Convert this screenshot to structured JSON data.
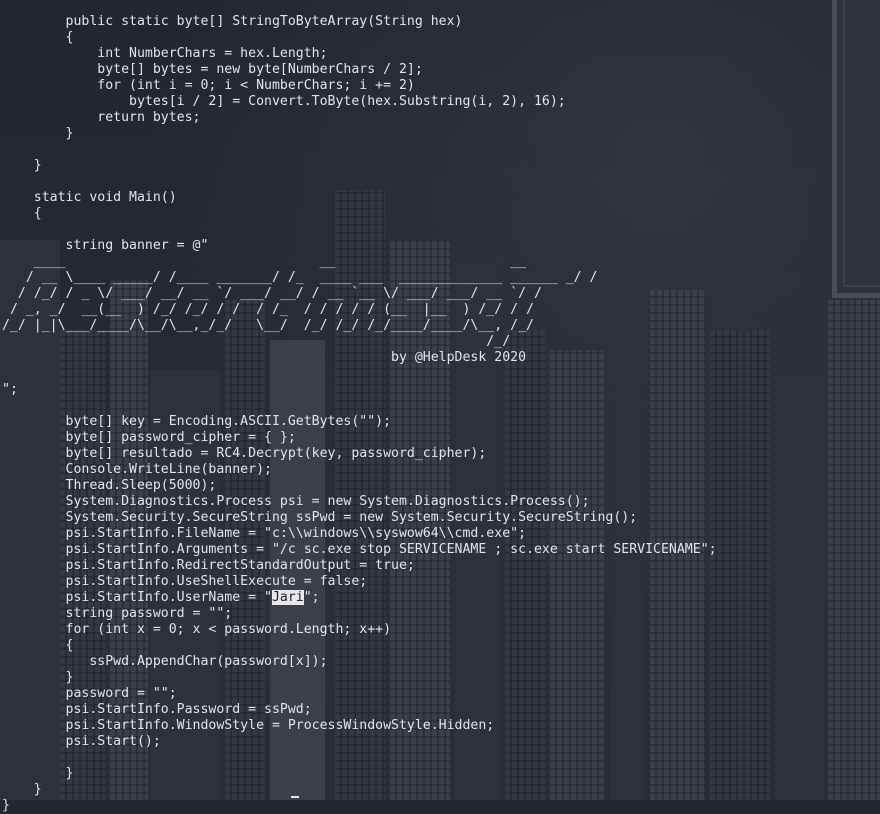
{
  "terminal": {
    "lines": [
      "        public static byte[] StringToByteArray(String hex)",
      "        {",
      "            int NumberChars = hex.Length;",
      "            byte[] bytes = new byte[NumberChars / 2];",
      "            for (int i = 0; i < NumberChars; i += 2)",
      "                bytes[i / 2] = Convert.ToByte(hex.Substring(i, 2), 16);",
      "            return bytes;",
      "        }",
      "",
      "    }",
      "",
      "    static void Main()",
      "    {",
      "",
      "        string banner = @\"",
      "    ____                                __                      __",
      "   / __ \\____ _____/ /____ _______/ /_  ____ ___  _____________ ______ _/ /",
      "  / /_/ / _ \\/ ___/ __/ __ `/ ___/ __/ / __ `__ \\/ ___/ ___/ __ `/ /",
      " / _, _/  __(__  ) /_/ /_/ / /  / /_  / / / / / (__  |__  ) /_/ / /",
      "/_/ |_|\\___/____/\\__/\\__,_/_/   \\__/  /_/ /_/ /_/____/____/\\__, /_/",
      "                                                             /_/",
      "                                                 by @HelpDesk 2020",
      "",
      "\";",
      "",
      "        byte[] key = Encoding.ASCII.GetBytes(\"\");",
      "        byte[] password_cipher = { };",
      "        byte[] resultado = RC4.Decrypt(key, password_cipher);",
      "        Console.WriteLine(banner);",
      "        Thread.Sleep(5000);",
      "        System.Diagnostics.Process psi = new System.Diagnostics.Process();",
      "        System.Security.SecureString ssPwd = new System.Security.SecureString();",
      "        psi.StartInfo.FileName = \"c:\\\\windows\\\\syswow64\\\\cmd.exe\";",
      "        psi.StartInfo.Arguments = \"/c sc.exe stop SERVICENAME ; sc.exe start SERVICENAME\";",
      "        psi.StartInfo.RedirectStandardOutput = true;",
      "        psi.StartInfo.UseShellExecute = false;"
    ],
    "username_prefix": "        psi.StartInfo.UserName = \"",
    "username_value": "Jari",
    "username_suffix": "\";",
    "lines_after": [
      "        string password = \"\";",
      "        for (int x = 0; x < password.Length; x++)",
      "        {",
      "           ssPwd.AppendChar(password[x]);",
      "        }",
      "        password = \"\";",
      "        psi.StartInfo.Password = ssPwd;",
      "        psi.StartInfo.WindowStyle = ProcessWindowStyle.Hidden;",
      "        psi.Start();",
      "",
      "        }",
      "    }",
      "}"
    ]
  },
  "colors": {
    "background": "#242731",
    "text": "#e2e4ea",
    "highlight": "#e8e8ec"
  }
}
